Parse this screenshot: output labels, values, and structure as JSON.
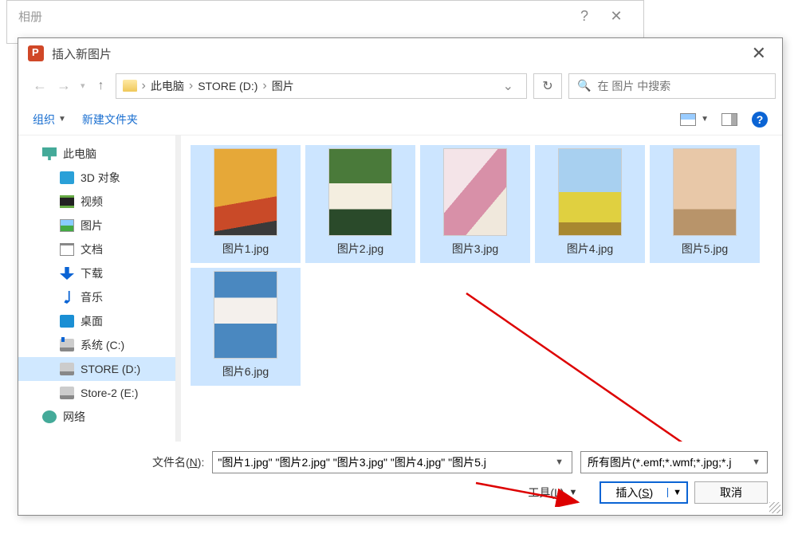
{
  "outer": {
    "title": "相册",
    "help": "?",
    "close": "✕"
  },
  "dialog": {
    "title": "插入新图片",
    "close": "✕"
  },
  "breadcrumb": {
    "crumbs": [
      "此电脑",
      "STORE (D:)",
      "图片"
    ]
  },
  "search": {
    "placeholder": "在 图片 中搜索"
  },
  "toolbar": {
    "organize": "组织",
    "new_folder": "新建文件夹"
  },
  "sidebar": {
    "items": [
      {
        "label": "此电脑",
        "ico": "ico-pc",
        "indent": false
      },
      {
        "label": "3D 对象",
        "ico": "ico-3d",
        "indent": true
      },
      {
        "label": "视频",
        "ico": "ico-video",
        "indent": true
      },
      {
        "label": "图片",
        "ico": "ico-pic",
        "indent": true
      },
      {
        "label": "文档",
        "ico": "ico-doc",
        "indent": true
      },
      {
        "label": "下载",
        "ico": "ico-down",
        "indent": true
      },
      {
        "label": "音乐",
        "ico": "ico-music",
        "indent": true
      },
      {
        "label": "桌面",
        "ico": "ico-desk",
        "indent": true
      },
      {
        "label": "系统 (C:)",
        "ico": "ico-drive-c",
        "indent": true
      },
      {
        "label": "STORE (D:)",
        "ico": "ico-drive",
        "indent": true,
        "selected": true
      },
      {
        "label": "Store-2 (E:)",
        "ico": "ico-drive",
        "indent": true
      },
      {
        "label": "网络",
        "ico": "ico-net",
        "indent": false
      }
    ]
  },
  "files": [
    {
      "label": "图片1.jpg",
      "thumb": "th1",
      "selected": true
    },
    {
      "label": "图片2.jpg",
      "thumb": "th2",
      "selected": true
    },
    {
      "label": "图片3.jpg",
      "thumb": "th3",
      "selected": true
    },
    {
      "label": "图片4.jpg",
      "thumb": "th4",
      "selected": true
    },
    {
      "label": "图片5.jpg",
      "thumb": "th5",
      "selected": true
    },
    {
      "label": "图片6.jpg",
      "thumb": "th6",
      "selected": true
    }
  ],
  "footer": {
    "filename_label_pre": "文件名(",
    "filename_label_u": "N",
    "filename_label_post": "):",
    "filename_value": "\"图片1.jpg\" \"图片2.jpg\" \"图片3.jpg\" \"图片4.jpg\" \"图片5.j",
    "filter": "所有图片(*.emf;*.wmf;*.jpg;*.j",
    "tools_pre": "工具(",
    "tools_u": "L",
    "tools_post": ")",
    "insert_pre": "插入(",
    "insert_u": "S",
    "insert_post": ")",
    "cancel": "取消"
  }
}
